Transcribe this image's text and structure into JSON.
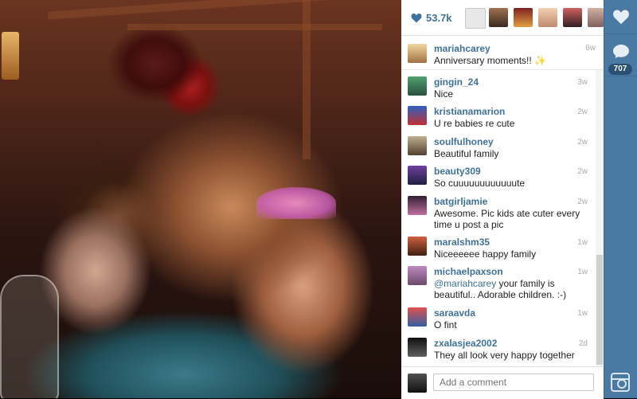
{
  "likes": {
    "count": "53.7k",
    "icon": "heart-icon"
  },
  "likers": [
    "liker-1",
    "liker-2",
    "liker-3",
    "liker-4",
    "liker-5",
    "liker-6"
  ],
  "caption": {
    "username": "mariahcarey",
    "text": "Anniversary moments!! ✨",
    "time": "6w"
  },
  "comments": [
    {
      "username": "gingin_24",
      "text": "Nice",
      "time": "3w"
    },
    {
      "username": "kristianamarion",
      "text": "U re babies re cute",
      "time": "2w"
    },
    {
      "username": "soulfulhoney",
      "text": "Beautiful family",
      "time": "2w"
    },
    {
      "username": "beauty309",
      "text": "So cuuuuuuuuuuuute",
      "time": "2w"
    },
    {
      "username": "batgirljamie",
      "text": "Awesome. Pic kids ate cuter every time u post a pic",
      "time": "2w"
    },
    {
      "username": "maralshm35",
      "text": "Niceeeeee happy family",
      "time": "1w"
    },
    {
      "username": "michaelpaxson",
      "mention": "@mariahcarey",
      "text": " your family is beautiful.. Adorable children. :-)",
      "time": "1w"
    },
    {
      "username": "saraavda",
      "text": "O fint",
      "time": "1w"
    },
    {
      "username": "zxalasjea2002",
      "text": "They all look very happy together",
      "time": "2d"
    }
  ],
  "add_comment": {
    "placeholder": "Add a comment"
  },
  "rail": {
    "comment_count": "707",
    "like_icon": "heart-icon",
    "comment_icon": "speech-bubble-icon",
    "app_icon": "instagram-icon"
  },
  "colors": {
    "accent": "#3f729b",
    "rail": "#4a7aa3"
  }
}
